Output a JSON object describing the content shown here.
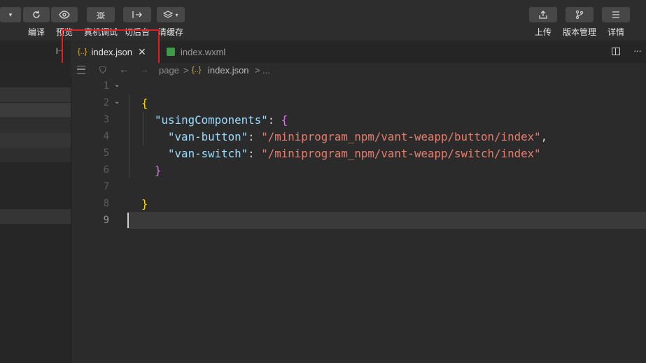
{
  "toolbar": {
    "left_buttons": [
      {
        "label": "编译",
        "icon": "compile-refresh-icon"
      },
      {
        "label": "预览",
        "icon": "preview-eye-icon"
      },
      {
        "label": "真机调试",
        "icon": "debug-bug-icon"
      },
      {
        "label": "切后台",
        "icon": "switch-background-icon"
      },
      {
        "label": "清缓存",
        "icon": "clear-cache-layers-icon"
      }
    ],
    "right_buttons": [
      {
        "label": "上传",
        "icon": "upload-icon"
      },
      {
        "label": "版本管理",
        "icon": "branch-icon"
      },
      {
        "label": "详情",
        "icon": "menu-icon"
      }
    ]
  },
  "tabs": [
    {
      "label": "index.json",
      "icon": "json-braces-icon",
      "active": true
    },
    {
      "label": "index.wxml",
      "icon": "wxml-file-icon",
      "active": false
    }
  ],
  "tab_close": "✕",
  "breadcrumb": {
    "segments": [
      "page",
      "index.json",
      "..."
    ],
    "sep": ">"
  },
  "editor": {
    "line_numbers": [
      "1",
      "2",
      "3",
      "4",
      "5",
      "6",
      "7",
      "8",
      "9"
    ],
    "tokens": {
      "open_brace": "{",
      "key_using": "\"usingComponents\"",
      "colon": ": ",
      "open_brace2": "{",
      "key_button": "\"van-button\"",
      "val_button": "\"/miniprogram_npm/vant-weapp/button/index\"",
      "comma": ",",
      "key_switch": "\"van-switch\"",
      "val_switch": "\"/miniprogram_npm/vant-weapp/switch/index\"",
      "close_brace2": "}",
      "close_brace": "}"
    },
    "current_line": 9
  },
  "colors": {
    "highlight_box": "#e02020",
    "brace_level1": "#ffd400",
    "brace_level2": "#d576e6",
    "json_key": "#9cdcfe",
    "json_string": "#e67e6d"
  }
}
